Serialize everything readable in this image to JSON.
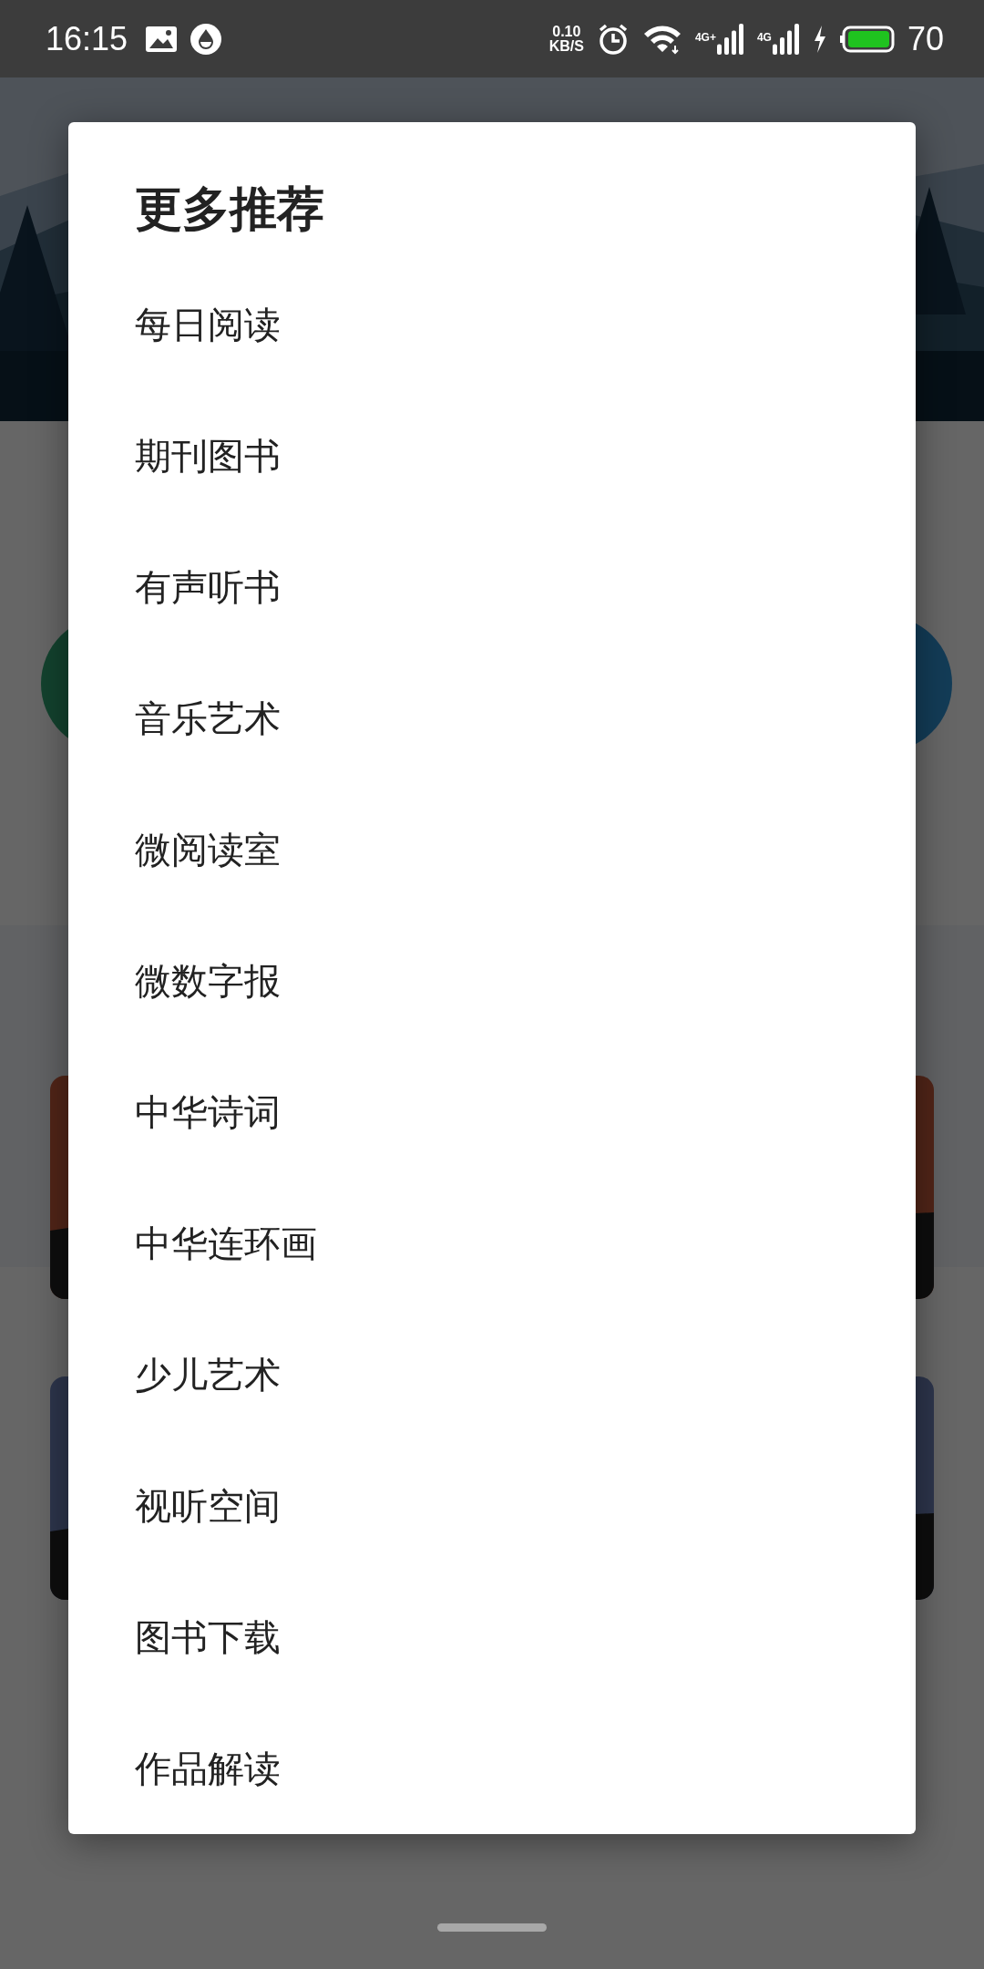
{
  "status_bar": {
    "time": "16:15",
    "net_speed": "0.10",
    "net_unit": "KB/S",
    "sim_1": "4G+",
    "sim_2": "4G",
    "battery": "70"
  },
  "dialog": {
    "title": "更多推荐",
    "items": [
      "每日阅读",
      "期刊图书",
      "有声听书",
      "音乐艺术",
      "微阅读室",
      "微数字报",
      "中华诗词",
      "中华连环画",
      "少儿艺术",
      "视听空间",
      "图书下载",
      "作品解读"
    ]
  }
}
